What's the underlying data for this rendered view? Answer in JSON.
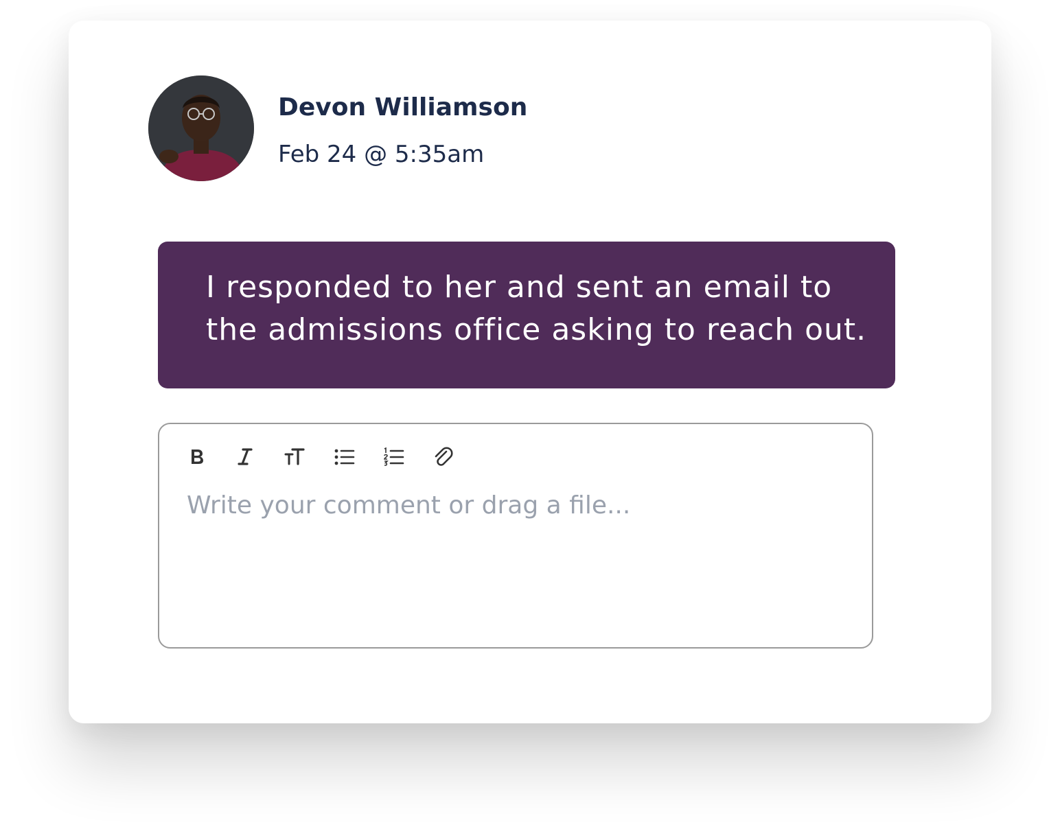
{
  "comment": {
    "author": "Devon Williamson",
    "timestamp": "Feb 24 @ 5:35am",
    "message": "I responded to her and sent an email to the admissions office asking to reach out.",
    "bubble_color": "#502c59"
  },
  "editor": {
    "placeholder": "Write your comment or drag a file...",
    "value": "",
    "toolbar": [
      {
        "name": "bold",
        "icon": "bold-icon"
      },
      {
        "name": "italic",
        "icon": "italic-icon"
      },
      {
        "name": "text-size",
        "icon": "text-size-icon"
      },
      {
        "name": "bulleted-list",
        "icon": "bulleted-list-icon"
      },
      {
        "name": "numbered-list",
        "icon": "numbered-list-icon"
      },
      {
        "name": "attachment",
        "icon": "paperclip-icon"
      }
    ]
  },
  "colors": {
    "text_primary": "#1d2b4a",
    "placeholder": "#9aa1ad",
    "editor_border": "#9a9a9a"
  }
}
